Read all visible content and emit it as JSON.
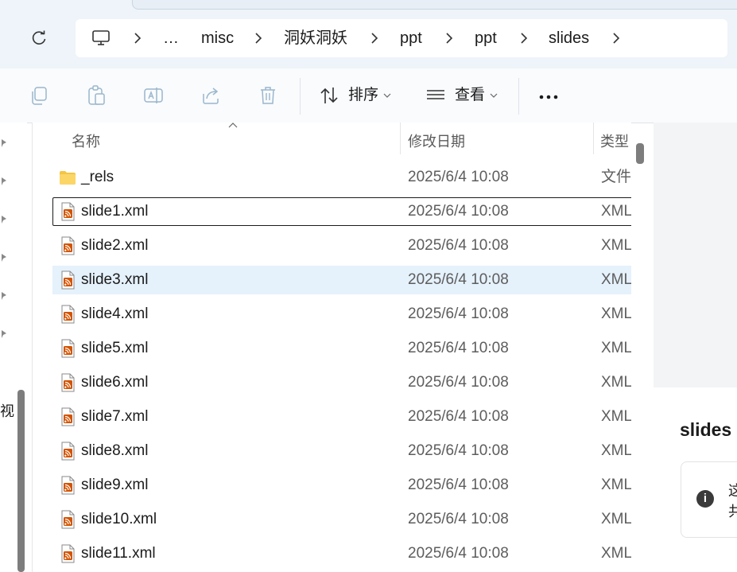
{
  "address_bar": {
    "crumbs": [
      "…",
      "misc",
      "洞妖洞妖",
      "ppt",
      "ppt",
      "slides"
    ],
    "icons": [
      "computer-icon",
      "refresh-icon",
      "chevron-right-icon"
    ]
  },
  "toolbar": {
    "sort_label": "排序",
    "view_label": "查看",
    "icons": [
      "copy-icon",
      "paste-icon",
      "rename-icon",
      "share-icon",
      "delete-icon",
      "sort-icon",
      "view-icon",
      "more-icon"
    ]
  },
  "nav": {
    "fragment": "视"
  },
  "file_list": {
    "columns": [
      "名称",
      "修改日期",
      "类型"
    ],
    "rows": [
      {
        "name": "_rels",
        "date": "2025/6/4 10:08",
        "type": "文件夹",
        "kind": "folder"
      },
      {
        "name": "slide1.xml",
        "date": "2025/6/4 10:08",
        "type": "XML",
        "kind": "xml",
        "state": "focused"
      },
      {
        "name": "slide2.xml",
        "date": "2025/6/4 10:08",
        "type": "XML",
        "kind": "xml"
      },
      {
        "name": "slide3.xml",
        "date": "2025/6/4 10:08",
        "type": "XML",
        "kind": "xml",
        "state": "hover"
      },
      {
        "name": "slide4.xml",
        "date": "2025/6/4 10:08",
        "type": "XML",
        "kind": "xml"
      },
      {
        "name": "slide5.xml",
        "date": "2025/6/4 10:08",
        "type": "XML",
        "kind": "xml"
      },
      {
        "name": "slide6.xml",
        "date": "2025/6/4 10:08",
        "type": "XML",
        "kind": "xml"
      },
      {
        "name": "slide7.xml",
        "date": "2025/6/4 10:08",
        "type": "XML",
        "kind": "xml"
      },
      {
        "name": "slide8.xml",
        "date": "2025/6/4 10:08",
        "type": "XML",
        "kind": "xml"
      },
      {
        "name": "slide9.xml",
        "date": "2025/6/4 10:08",
        "type": "XML",
        "kind": "xml"
      },
      {
        "name": "slide10.xml",
        "date": "2025/6/4 10:08",
        "type": "XML",
        "kind": "xml"
      },
      {
        "name": "slide11.xml",
        "date": "2025/6/4 10:08",
        "type": "XML",
        "kind": "xml"
      }
    ]
  },
  "details": {
    "title": "slides (",
    "info_text": "这共"
  },
  "colors": {
    "hover_row": "#e5f1fb",
    "folder": "#f4c542",
    "xml_icon": "#d35400",
    "address_bg": "#eef4f9"
  }
}
